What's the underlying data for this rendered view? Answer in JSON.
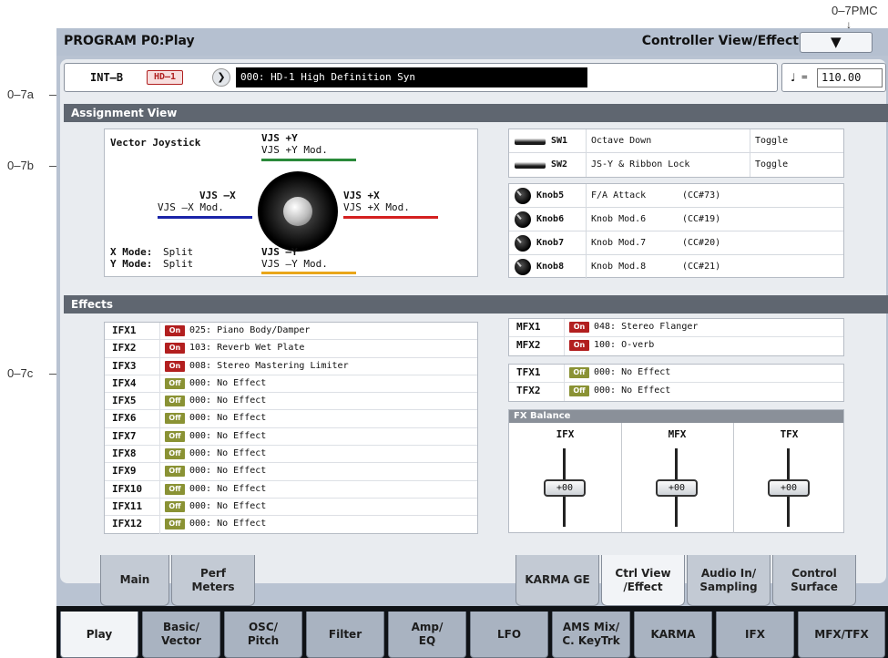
{
  "callouts": {
    "pmc": "0–7PMC",
    "a": "0–7a",
    "b": "0–7b",
    "c": "0–7c"
  },
  "header": {
    "title": "PROGRAM P0:Play",
    "page": "Controller View/Effect",
    "menu_icon": "chevron-down-icon"
  },
  "program": {
    "bank": "INT–B",
    "engine_badge": "HD–1",
    "select_icon": "chevron-right-icon",
    "name": "000: HD-1 High Definition Syn"
  },
  "tempo": {
    "note": "♩",
    "eq": "=",
    "value": "110.00"
  },
  "assignment": {
    "header": "Assignment View",
    "joystick": {
      "title": "Vector Joystick",
      "up_label": "VJS +Y",
      "up_mod": "VJS +Y Mod.",
      "left_label": "VJS –X",
      "left_mod": "VJS –X Mod.",
      "right_label": "VJS +X",
      "right_mod": "VJS +X Mod.",
      "down_label": "VJS –Y",
      "down_mod": "VJS –Y Mod.",
      "xmode_label": "X Mode:",
      "xmode_value": "Split",
      "ymode_label": "Y Mode:",
      "ymode_value": "Split",
      "colors": {
        "up": "#2a8a3a",
        "left": "#1a24a8",
        "right": "#d42020",
        "down": "#e9a61a"
      }
    },
    "switches": [
      {
        "name": "SW1",
        "function": "Octave Down",
        "mode": "Toggle"
      },
      {
        "name": "SW2",
        "function": "JS-Y & Ribbon Lock",
        "mode": "Toggle"
      }
    ],
    "knobs": [
      {
        "name": "Knob5",
        "function": "F/A Attack",
        "cc": "(CC#73)"
      },
      {
        "name": "Knob6",
        "function": "Knob Mod.6",
        "cc": "(CC#19)"
      },
      {
        "name": "Knob7",
        "function": "Knob Mod.7",
        "cc": "(CC#20)"
      },
      {
        "name": "Knob8",
        "function": "Knob Mod.8",
        "cc": "(CC#21)"
      }
    ]
  },
  "effects": {
    "header": "Effects",
    "ifx": [
      {
        "name": "IFX1",
        "state": "On",
        "effect": "025: Piano Body/Damper"
      },
      {
        "name": "IFX2",
        "state": "On",
        "effect": "103: Reverb Wet Plate"
      },
      {
        "name": "IFX3",
        "state": "On",
        "effect": "008: Stereo Mastering Limiter"
      },
      {
        "name": "IFX4",
        "state": "Off",
        "effect": "000: No Effect"
      },
      {
        "name": "IFX5",
        "state": "Off",
        "effect": "000: No Effect"
      },
      {
        "name": "IFX6",
        "state": "Off",
        "effect": "000: No Effect"
      },
      {
        "name": "IFX7",
        "state": "Off",
        "effect": "000: No Effect"
      },
      {
        "name": "IFX8",
        "state": "Off",
        "effect": "000: No Effect"
      },
      {
        "name": "IFX9",
        "state": "Off",
        "effect": "000: No Effect"
      },
      {
        "name": "IFX10",
        "state": "Off",
        "effect": "000: No Effect"
      },
      {
        "name": "IFX11",
        "state": "Off",
        "effect": "000: No Effect"
      },
      {
        "name": "IFX12",
        "state": "Off",
        "effect": "000: No Effect"
      }
    ],
    "mfx": [
      {
        "name": "MFX1",
        "state": "On",
        "effect": "048: Stereo Flanger"
      },
      {
        "name": "MFX2",
        "state": "On",
        "effect": "100: O-verb"
      }
    ],
    "tfx": [
      {
        "name": "TFX1",
        "state": "Off",
        "effect": "000: No Effect"
      },
      {
        "name": "TFX2",
        "state": "Off",
        "effect": "000: No Effect"
      }
    ],
    "balance": {
      "header": "FX Balance",
      "columns": [
        {
          "label": "IFX",
          "value": "+00"
        },
        {
          "label": "MFX",
          "value": "+00"
        },
        {
          "label": "TFX",
          "value": "+00"
        }
      ]
    }
  },
  "tabs_upper": [
    {
      "label": "Main",
      "selected": false
    },
    {
      "label": "Perf\nMeters",
      "selected": false
    },
    {
      "label": "KARMA GE",
      "selected": false
    },
    {
      "label": "Ctrl View\n/Effect",
      "selected": true
    },
    {
      "label": "Audio In/\nSampling",
      "selected": false
    },
    {
      "label": "Control\nSurface",
      "selected": false
    }
  ],
  "tabs_lower": [
    {
      "label": "Play",
      "selected": true
    },
    {
      "label": "Basic/\nVector",
      "selected": false
    },
    {
      "label": "OSC/\nPitch",
      "selected": false
    },
    {
      "label": "Filter",
      "selected": false
    },
    {
      "label": "Amp/\nEQ",
      "selected": false
    },
    {
      "label": "LFO",
      "selected": false
    },
    {
      "label": "AMS Mix/\nC. KeyTrk",
      "selected": false
    },
    {
      "label": "KARMA",
      "selected": false
    },
    {
      "label": "IFX",
      "selected": false
    },
    {
      "label": "MFX/TFX",
      "selected": false
    }
  ]
}
